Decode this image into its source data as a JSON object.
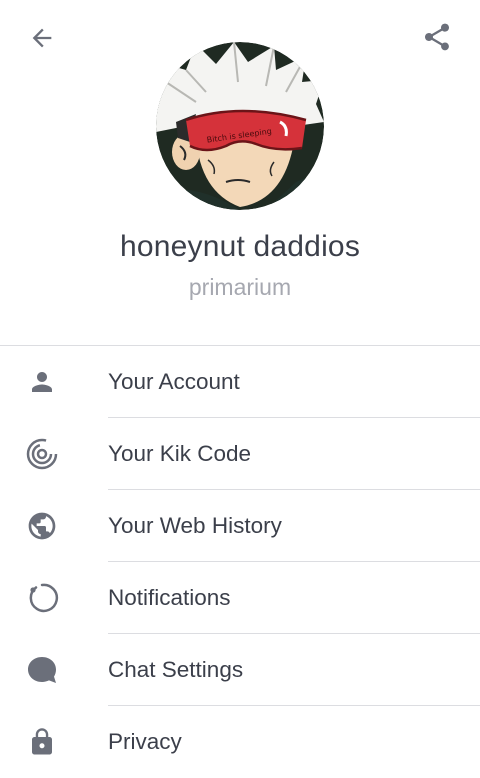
{
  "header": {
    "back_icon": "arrow-left-icon",
    "share_icon": "share-icon"
  },
  "profile": {
    "display_name": "honeynut daddios",
    "username": "primarium",
    "avatar_sleep_mask_text": "Bitch is sleeping"
  },
  "menu": {
    "items": [
      {
        "label": "Your Account",
        "icon": "person-icon"
      },
      {
        "label": "Your Kik Code",
        "icon": "kik-code-icon"
      },
      {
        "label": "Your Web History",
        "icon": "globe-icon"
      },
      {
        "label": "Notifications",
        "icon": "notification-ring-icon"
      },
      {
        "label": "Chat Settings",
        "icon": "chat-bubble-icon"
      },
      {
        "label": "Privacy",
        "icon": "lock-icon"
      }
    ]
  },
  "colors": {
    "text": "#3b3f4a",
    "muted": "#a6a8b0",
    "icon": "#6b6f7a",
    "divider": "#dcdde1"
  }
}
